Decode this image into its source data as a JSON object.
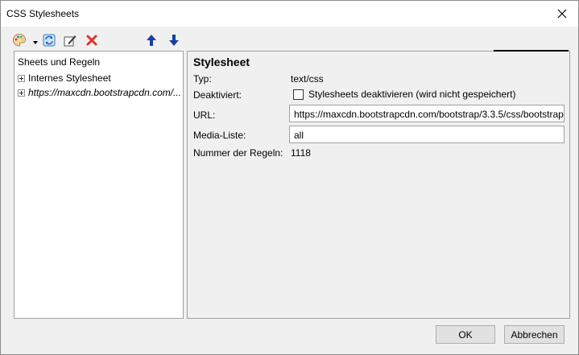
{
  "window": {
    "title": "CSS Stylesheets"
  },
  "toolbar": {
    "icons": [
      "palette-icon",
      "dropdown-caret-icon",
      "refresh-icon",
      "edit-icon",
      "delete-icon",
      "arrow-up-icon",
      "arrow-down-icon"
    ]
  },
  "tree": {
    "header": "Sheets und Regeln",
    "items": [
      {
        "label": "Internes Stylesheet"
      },
      {
        "label": "https://maxcdn.bootstrapcdn.com/..."
      }
    ]
  },
  "detail": {
    "title": "Stylesheet",
    "type_label": "Typ:",
    "type_value": "text/css",
    "disabled_label": "Deaktiviert:",
    "disabled_checkbox_label": "Stylesheets deaktivieren (wird nicht gespeichert)",
    "url_label": "URL:",
    "url_value": "https://maxcdn.bootstrapcdn.com/bootstrap/3.3.5/css/bootstrap",
    "media_label": "Media-Liste:",
    "media_value": "all",
    "rules_label": "Nummer der Regeln:",
    "rules_value": "1118"
  },
  "buttons": {
    "ok": "OK",
    "cancel": "Abbrechen"
  },
  "colors": {
    "arrow": "#1a3fa3",
    "delete": "#d9352b",
    "refresh": "#2a7fd4"
  }
}
